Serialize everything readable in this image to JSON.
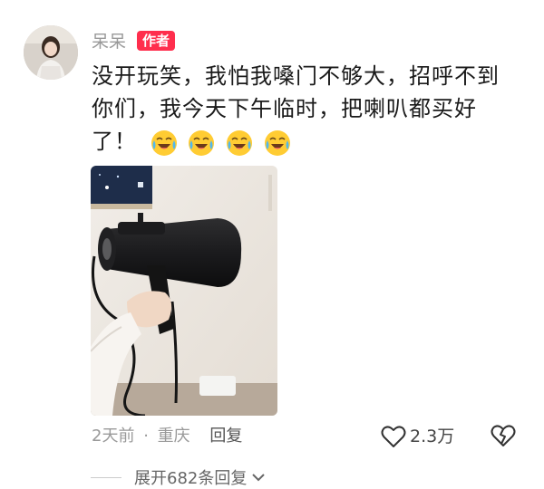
{
  "comment": {
    "author": "呆呆",
    "author_badge": "作者",
    "text": "没开玩笑，我怕我嗓门不够大，招呼不到你们，我今天下午临时，把喇叭都买好了！",
    "emojis": [
      "crying-laughing-emoji",
      "crying-laughing-emoji",
      "crying-laughing-emoji",
      "crying-laughing-emoji"
    ],
    "meta": {
      "time": "2天前",
      "separator": "·",
      "location": "重庆",
      "reply_label": "回复"
    },
    "like_count": "2.3万",
    "expand_label": "展开682条回复"
  },
  "colors": {
    "badge_bg": "#ff2e4d",
    "meta_text": "#999999",
    "body_text": "#1a1a1a"
  },
  "icons": {
    "like": "heart-outline-icon",
    "dislike": "broken-heart-icon",
    "expand": "chevron-down-icon"
  }
}
